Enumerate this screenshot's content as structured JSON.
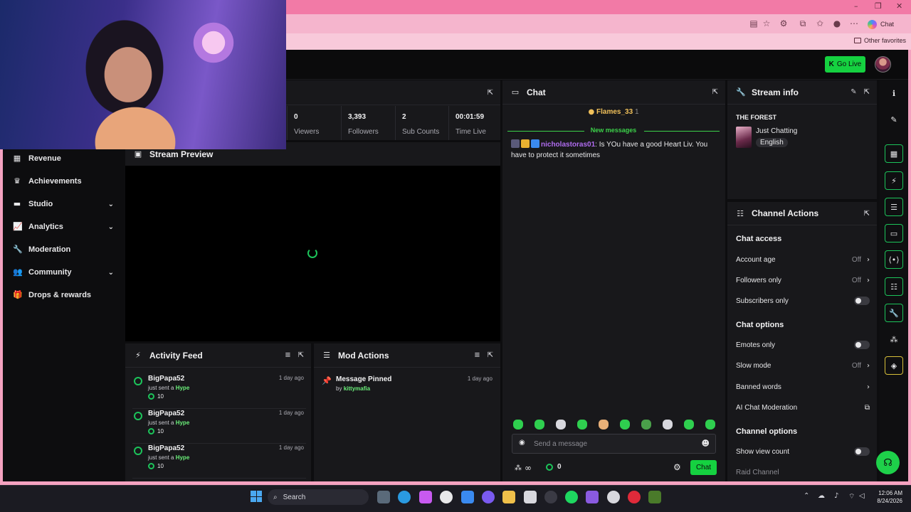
{
  "window": {
    "minimize": "–",
    "restore": "❐",
    "close": "✕"
  },
  "browser": {
    "copilot_label": "Chat",
    "favorites_label": "Other favorites"
  },
  "header": {
    "go_live_label": "Go Live"
  },
  "sidebar": {
    "items": [
      {
        "label": "Revenue",
        "icon": "revenue-icon"
      },
      {
        "label": "Achievements",
        "icon": "trophy-icon"
      },
      {
        "label": "Studio",
        "icon": "studio-icon",
        "expandable": true
      },
      {
        "label": "Analytics",
        "icon": "analytics-icon",
        "expandable": true
      },
      {
        "label": "Moderation",
        "icon": "wrench-icon"
      },
      {
        "label": "Community",
        "icon": "community-icon",
        "expandable": true
      },
      {
        "label": "Drops & rewards",
        "icon": "gift-icon"
      }
    ]
  },
  "stats": [
    {
      "value": "0",
      "label": "Viewers"
    },
    {
      "value": "3,393",
      "label": "Followers"
    },
    {
      "value": "2",
      "label": "Sub Counts"
    },
    {
      "value": "00:01:59",
      "label": "Time Live"
    }
  ],
  "preview": {
    "title": "Stream Preview"
  },
  "activity": {
    "title": "Activity Feed",
    "items": [
      {
        "user": "BigPapa52",
        "action": "just sent a",
        "item": "Hype",
        "amount": "10",
        "time": "1 day ago"
      },
      {
        "user": "BigPapa52",
        "action": "just sent a",
        "item": "Hype",
        "amount": "10",
        "time": "1 day ago"
      },
      {
        "user": "BigPapa52",
        "action": "just sent a",
        "item": "Hype",
        "amount": "10",
        "time": "1 day ago"
      }
    ]
  },
  "mod_actions": {
    "title": "Mod Actions",
    "items": [
      {
        "action": "Message Pinned",
        "by_prefix": "by",
        "by_user": "kittymafia",
        "time": "1 day ago"
      }
    ]
  },
  "chat": {
    "title": "Chat",
    "top_user": "Flames_33",
    "top_user_count": "1",
    "new_messages_label": "New messages",
    "message": {
      "user": "nicholastoras01",
      "text": ": Is YOu have a good Heart Liv. You have to protect it sometimes"
    },
    "input_placeholder": "Send a message",
    "viewers_symbol": "∞",
    "coin_balance": "0",
    "send_label": "Chat"
  },
  "stream_info": {
    "title": "Stream info",
    "stream_title": "THE FOREST",
    "category": "Just Chatting",
    "language": "English"
  },
  "channel_actions": {
    "title": "Channel Actions",
    "chat_access_title": "Chat access",
    "chat_access": [
      {
        "label": "Account age",
        "value": "Off"
      },
      {
        "label": "Followers only",
        "value": "Off"
      },
      {
        "label": "Subscribers only",
        "toggle": false
      }
    ],
    "chat_options_title": "Chat options",
    "chat_options": [
      {
        "label": "Emotes only",
        "toggle": false
      },
      {
        "label": "Slow mode",
        "value": "Off"
      },
      {
        "label": "Banned words"
      },
      {
        "label": "AI Chat Moderation"
      }
    ],
    "channel_options_title": "Channel options",
    "channel_options": [
      {
        "label": "Show view count",
        "toggle": false
      },
      {
        "label": "Raid Channel"
      }
    ]
  },
  "taskbar": {
    "search_label": "Search",
    "time": "12:06 AM",
    "date": "8/24/2026"
  },
  "colors": {
    "accent": "#15d140",
    "panel": "#18181b",
    "background": "#0d0d0f",
    "browser_frame": "#f27aa6"
  }
}
